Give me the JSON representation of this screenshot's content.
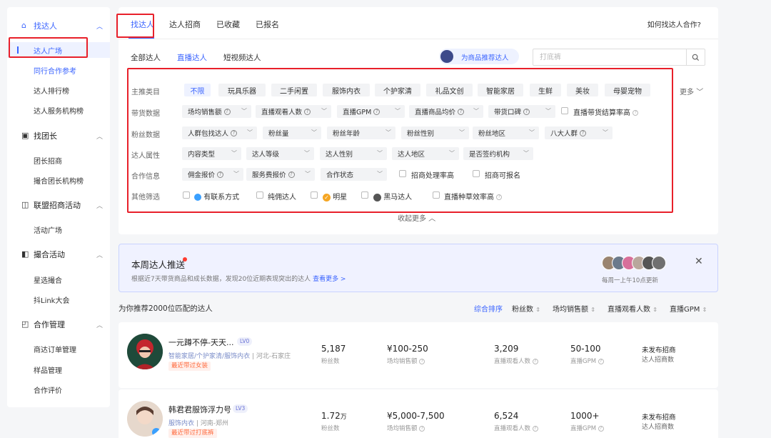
{
  "sidebar": {
    "groups": [
      {
        "label": "找达人",
        "icon": "home-icon",
        "items": [
          "达人广场",
          "同行合作参考",
          "达人排行榜",
          "达人服务机构榜"
        ]
      },
      {
        "label": "找团长",
        "icon": "briefcase-icon",
        "items": [
          "团长招商",
          "撮合团长机构榜"
        ]
      },
      {
        "label": "联盟招商活动",
        "icon": "megaphone-icon",
        "items": [
          "活动广场"
        ]
      },
      {
        "label": "撮合活动",
        "icon": "match-icon",
        "items": [
          "星选撮合",
          "抖Link大会"
        ]
      },
      {
        "label": "合作管理",
        "icon": "document-icon",
        "items": [
          "商达订单管理",
          "样品管理",
          "合作评价"
        ]
      }
    ]
  },
  "tabs": [
    "找达人",
    "达人招商",
    "已收藏",
    "已报名"
  ],
  "help_link": "如何找达人合作?",
  "subtabs": [
    "全部达人",
    "直播达人",
    "短视频达人"
  ],
  "recommend_button": "为商品推荐达人",
  "search": {
    "placeholder": "打底裤"
  },
  "filters": {
    "category": {
      "label": "主推类目",
      "options": [
        "不限",
        "玩具乐器",
        "二手闲置",
        "服饰内衣",
        "个护家清",
        "礼品文创",
        "智能家居",
        "生鲜",
        "美妆",
        "母婴宠物"
      ],
      "more": "更多"
    },
    "sales": {
      "label": "带货数据",
      "dropdowns": [
        "场均销售额",
        "直播观看人数",
        "直播GPM",
        "直播商品均价",
        "带货口碑"
      ],
      "checkbox": "直播带货结算率高"
    },
    "fans": {
      "label": "粉丝数据",
      "dropdowns": [
        "人群包找达人",
        "粉丝量",
        "粉丝年龄",
        "粉丝性别",
        "粉丝地区",
        "八大人群"
      ]
    },
    "attrs": {
      "label": "达人属性",
      "dropdowns": [
        "内容类型",
        "达人等级",
        "达人性别",
        "达人地区",
        "是否签约机构"
      ]
    },
    "coop": {
      "label": "合作信息",
      "dropdowns": [
        "佣金报价",
        "服务费报价",
        "合作状态"
      ],
      "checkboxes": [
        "招商处理率高",
        "招商可报名"
      ]
    },
    "other": {
      "label": "其他筛选",
      "checkboxes": [
        "有联系方式",
        "纯佣达人",
        "明星",
        "黑马达人",
        "直播种草效率高"
      ]
    },
    "collapse": "收起更多"
  },
  "weekly": {
    "title": "本周达人推送",
    "desc": "根据近7天带货商品和成长数据，发现20位近期表现突出的达人",
    "desc_link": "查看更多 >",
    "update": "每周一上午10点更新"
  },
  "results": {
    "count": "为你推荐2000位匹配的达人",
    "sorts": [
      "综合排序",
      "粉丝数",
      "场均销售额",
      "直播观看人数",
      "直播GPM"
    ]
  },
  "cards": [
    {
      "name": "一元蹲不停-天天...",
      "level": "LV0",
      "tags": "智能家居/个护家清/服饰内衣",
      "location": "河北-石家庄",
      "badge": "最近带过女装",
      "fans": "5,187",
      "fans_label": "粉丝数",
      "sales": "¥100-250",
      "sales_label": "场均销售额",
      "viewers": "3,209",
      "viewers_label": "直播观看人数",
      "gpm": "50-100",
      "gpm_label": "直播GPM",
      "recruit": "未发布招商",
      "recruit_label": "达人招商数"
    },
    {
      "name": "韩君君服饰浮力号",
      "level": "LV3",
      "tags": "服饰内衣",
      "location": "河南-郑州",
      "badge": "最近带过打底裤",
      "fans": "1.72",
      "fans_unit": "万",
      "fans_label": "粉丝数",
      "sales": "¥5,000-7,500",
      "sales_label": "场均销售额",
      "viewers": "6,524",
      "viewers_label": "直播观看人数",
      "gpm": "1000+",
      "gpm_label": "直播GPM",
      "recruit": "未发布招商",
      "recruit_label": "达人招商数"
    }
  ],
  "colors": {
    "accent": "#3a64ff",
    "highlight": "#e8202a"
  }
}
